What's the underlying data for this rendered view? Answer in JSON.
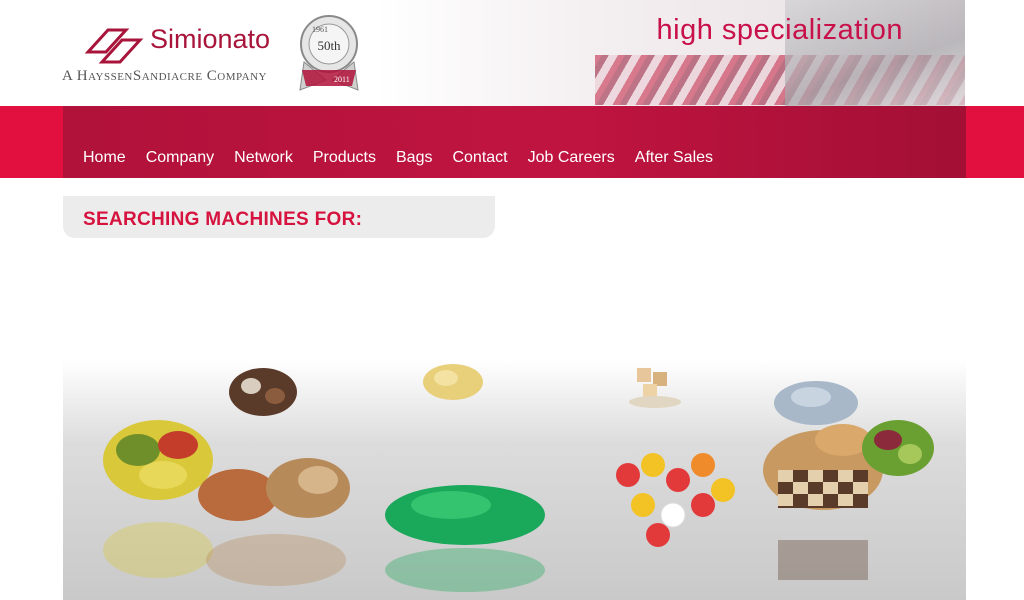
{
  "header": {
    "brand": "Simionato",
    "subtitle": "A HayssenSandiacre Company",
    "seal_years": {
      "start": "1961",
      "label": "50th",
      "end": "2011"
    },
    "tagline": "high specialization",
    "colors": {
      "brand": "#a8143a",
      "accent": "#e2103f",
      "tagline": "#c8104a"
    }
  },
  "nav": {
    "items": [
      {
        "label": "Home"
      },
      {
        "label": "Company"
      },
      {
        "label": "Network"
      },
      {
        "label": "Products"
      },
      {
        "label": "Bags"
      },
      {
        "label": "Contact"
      },
      {
        "label": "Job Careers"
      },
      {
        "label": "After Sales"
      }
    ]
  },
  "search": {
    "title": "SEARCHING MACHINES FOR:"
  },
  "showcase": {
    "items": [
      {
        "name": "pasta-tortellini-icon"
      },
      {
        "name": "chocolates-icon"
      },
      {
        "name": "nuts-icon"
      },
      {
        "name": "chips-icon"
      },
      {
        "name": "green-granules-icon"
      },
      {
        "name": "sugar-cubes-icon"
      },
      {
        "name": "gummy-bears-icon"
      },
      {
        "name": "pet-food-icon"
      },
      {
        "name": "cookies-icon"
      },
      {
        "name": "salad-icon"
      }
    ]
  }
}
